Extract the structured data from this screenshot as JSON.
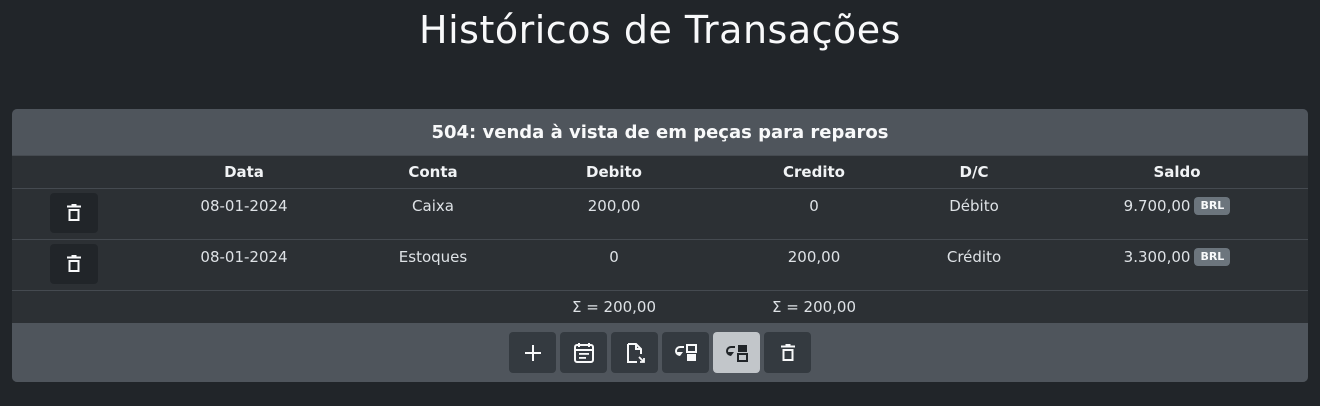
{
  "page": {
    "title": "Históricos de Transações"
  },
  "transaction": {
    "header": "504: venda à vista de em peças para reparos",
    "columns": {
      "data": "Data",
      "conta": "Conta",
      "debito": "Debito",
      "credito": "Credito",
      "dc": "D/C",
      "saldo": "Saldo"
    },
    "rows": [
      {
        "data": "08-01-2024",
        "conta": "Caixa",
        "debito": "200,00",
        "credito": "0",
        "dc": "Débito",
        "saldo": "9.700,00",
        "currency": "BRL"
      },
      {
        "data": "08-01-2024",
        "conta": "Estoques",
        "debito": "0",
        "credito": "200,00",
        "dc": "Crédito",
        "saldo": "3.300,00",
        "currency": "BRL"
      }
    ],
    "totals": {
      "debito": "Σ = 200,00",
      "credito": "Σ = 200,00"
    }
  },
  "toolbar": {
    "buttons": [
      {
        "icon": "plus-icon"
      },
      {
        "icon": "calendar-icon"
      },
      {
        "icon": "file-export-icon"
      },
      {
        "icon": "swap-left-icon"
      },
      {
        "icon": "swap-right-icon",
        "active": true
      },
      {
        "icon": "trash-icon"
      }
    ]
  },
  "colors": {
    "background": "#212529",
    "card": "#2c3034",
    "header": "#4f555c",
    "badge": "#6c757d",
    "active_button": "#c2c6ca"
  }
}
